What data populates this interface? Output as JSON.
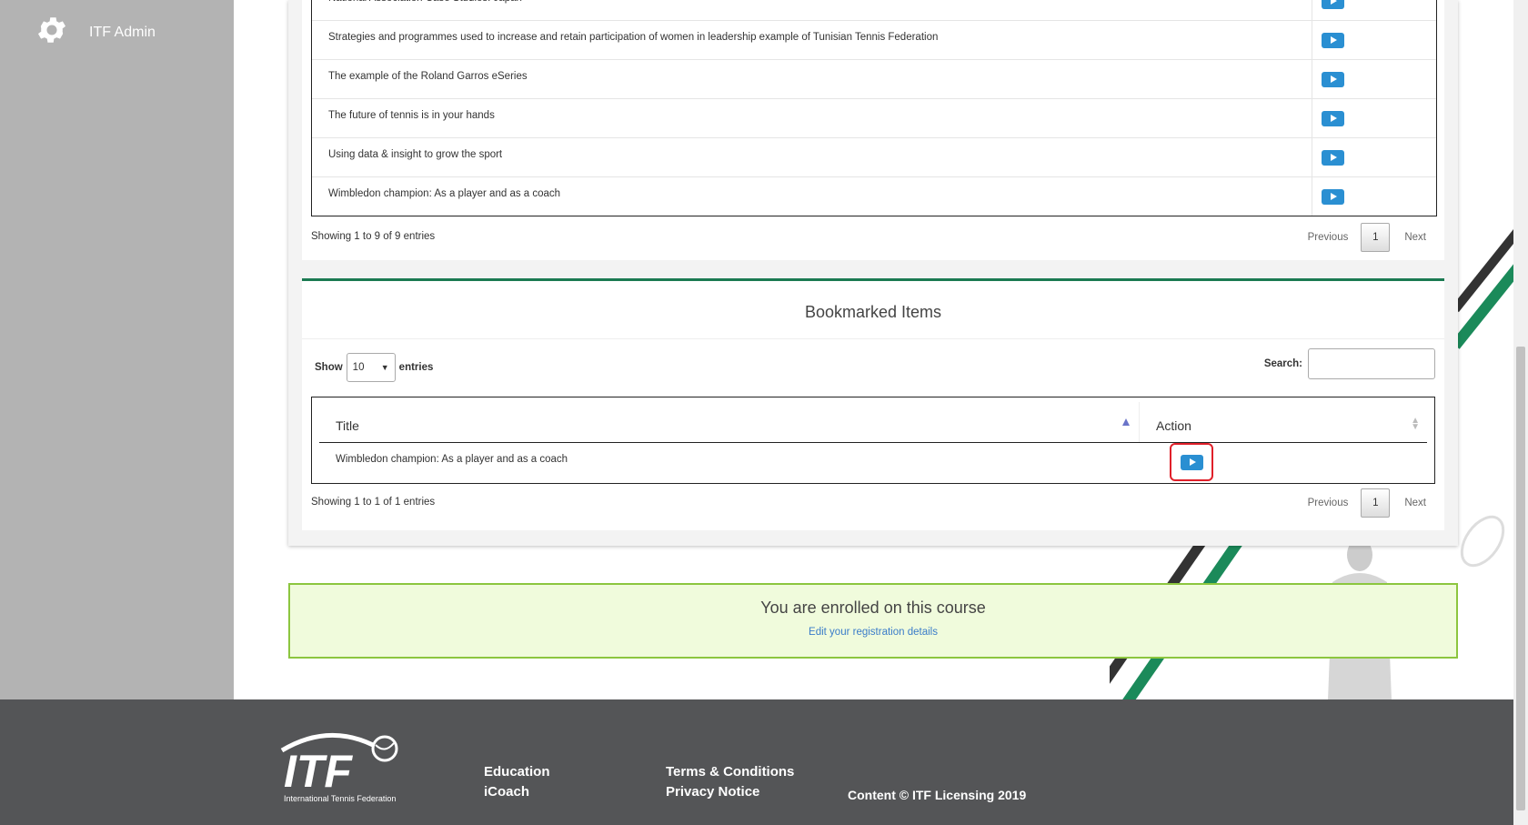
{
  "sidebar": {
    "title": "ITF Admin"
  },
  "top_table": {
    "rows": [
      "National Association Case Studies: Japan",
      "Strategies and programmes used to increase and retain participation of women in leadership example of Tunisian Tennis Federation",
      "The example of the Roland Garros eSeries",
      "The future of tennis is in your hands",
      "Using data & insight to grow the sport",
      "Wimbledon champion: As a player and as a coach"
    ],
    "info": "Showing 1 to 9 of 9 entries",
    "pager": {
      "previous": "Previous",
      "current": "1",
      "next": "Next"
    }
  },
  "bookmarks": {
    "title": "Bookmarked Items",
    "show_label": "Show",
    "show_value": "10",
    "entries_label": "entries",
    "search_label": "Search:",
    "columns": {
      "title": "Title",
      "action": "Action"
    },
    "rows": [
      "Wimbledon champion: As a player and as a coach"
    ],
    "info": "Showing 1 to 1 of 1 entries",
    "pager": {
      "previous": "Previous",
      "current": "1",
      "next": "Next"
    }
  },
  "enrolled": {
    "message": "You are enrolled on this course",
    "link": "Edit your registration details"
  },
  "footer": {
    "logo_text": "ITF",
    "logo_sub": "International Tennis Federation",
    "col1": [
      "Education",
      "iCoach"
    ],
    "col2": [
      "Terms & Conditions",
      "Privacy Notice"
    ],
    "copyright": "Content © ITF Licensing 2019"
  },
  "colors": {
    "accent_green": "#1b7a52",
    "play_blue": "#2a8fd2",
    "highlight_red": "#e0202a",
    "footer_bg": "#545557"
  }
}
